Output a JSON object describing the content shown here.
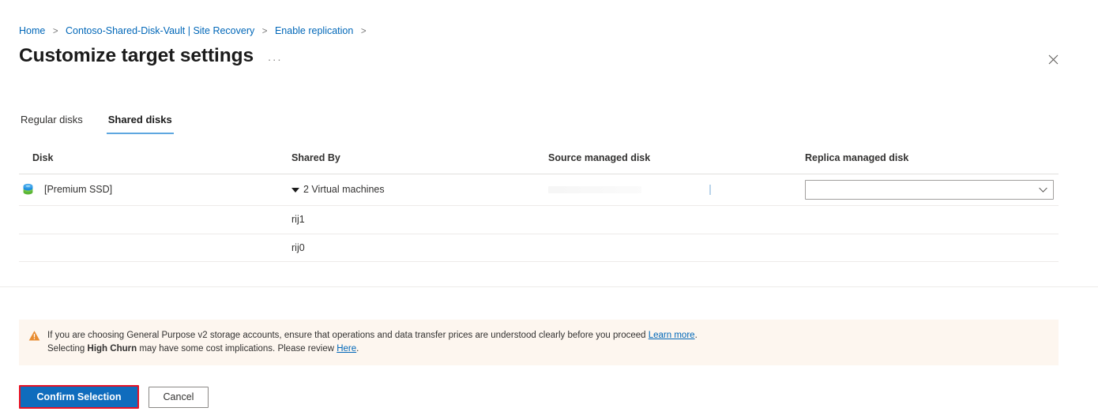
{
  "breadcrumb": {
    "items": [
      {
        "label": "Home"
      },
      {
        "label": "Contoso-Shared-Disk-Vault | Site Recovery"
      },
      {
        "label": "Enable replication"
      }
    ],
    "separator": ">"
  },
  "header": {
    "title": "Customize target settings",
    "more_label": "···",
    "close_label": "Close"
  },
  "tabs": [
    {
      "label": "Regular disks",
      "active": false
    },
    {
      "label": "Shared disks",
      "active": true
    }
  ],
  "table": {
    "columns": [
      "Disk",
      "Shared By",
      "Source managed disk",
      "Replica managed disk"
    ],
    "rows": [
      {
        "disk": "[Premium SSD]",
        "disk_icon": "managed-disk-icon",
        "shared_by": "2 Virtual machines",
        "shared_by_expanded": true,
        "source_managed_disk": "",
        "replica_managed_disk": ""
      },
      {
        "disk": "",
        "shared_by": "rij1",
        "source_managed_disk": "",
        "replica_managed_disk": ""
      },
      {
        "disk": "",
        "shared_by": "rij0",
        "source_managed_disk": "",
        "replica_managed_disk": ""
      }
    ]
  },
  "warning": {
    "icon": "warning-triangle-icon",
    "line1_pre": "If you are choosing General Purpose v2 storage accounts, ensure that operations and data transfer prices are understood clearly before you proceed ",
    "line1_link": "Learn more",
    "line1_post": ".",
    "line2_pre": "Selecting ",
    "line2_bold": "High Churn",
    "line2_mid": " may have some cost implications. Please review ",
    "line2_link": "Here",
    "line2_post": "."
  },
  "footer": {
    "confirm_label": "Confirm Selection",
    "cancel_label": "Cancel"
  },
  "colors": {
    "accent_blue": "#0f6cbd",
    "link_blue": "#0067b8",
    "tab_underline": "#5ea7e0",
    "warning_bg": "#fdf6ef",
    "warning_icon": "#e88c30",
    "highlight_red": "#e81123"
  }
}
